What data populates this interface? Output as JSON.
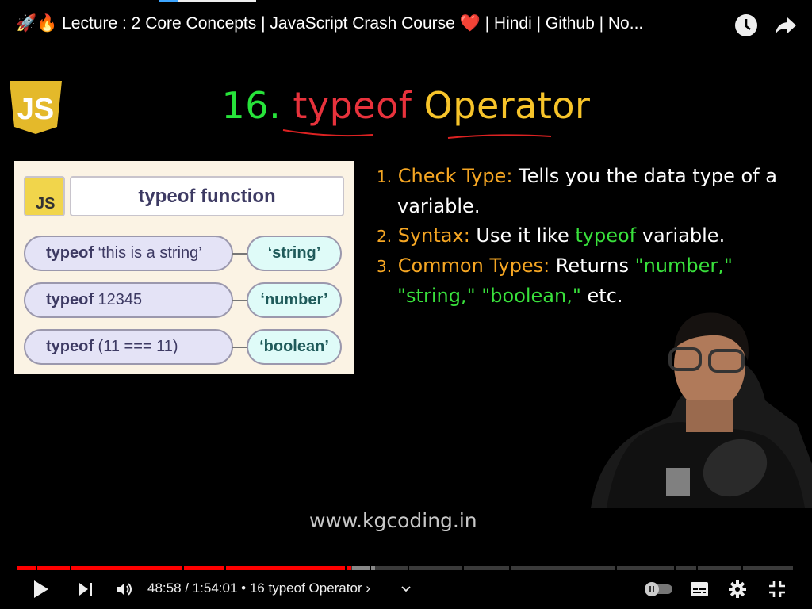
{
  "video_title": "🚀🔥 Lecture : 2 Core Concepts | JavaScript Crash Course ❤️ | Hindi | Github | No...",
  "top_icons": [
    "watch-later-icon",
    "share-icon"
  ],
  "slide": {
    "logo_text": "JS",
    "title_number": "16.",
    "title_word1": "typeof",
    "title_word2": "Operator",
    "card": {
      "badge": "JS",
      "header": "typeof function",
      "rows": [
        {
          "keyword": "typeof",
          "expr": " ‘this is a string’",
          "result": "‘string’"
        },
        {
          "keyword": "typeof",
          "expr": " 12345",
          "result": "‘number’"
        },
        {
          "keyword": "typeof",
          "expr": " (11 === 11)",
          "result": "‘boolean’"
        }
      ]
    },
    "points": [
      {
        "num": "1.",
        "label": "Check Type:",
        "text": " Tells you the data type of a variable."
      },
      {
        "num": "2.",
        "label": "Syntax:",
        "text": " Use it like ",
        "code": "typeof",
        "text2": " variable."
      },
      {
        "num": "3.",
        "label": "Common Types:",
        "text": " Returns ",
        "code": "\"number,\" \"string,\" \"boolean,\"",
        "text2": " etc."
      }
    ],
    "website": "www.kgcoding.in"
  },
  "player": {
    "current_time": "48:58",
    "duration": "1:54:01",
    "time_display": "48:58 / 1:54:01",
    "chapter": "• 16 typeof Operator",
    "played_fraction": 0.429,
    "colors": {
      "played": "#ff0000",
      "buffered": "#888888",
      "unplayed": "#3a3a3a"
    },
    "autoplay": "paused",
    "icons": [
      "play-icon",
      "next-icon",
      "volume-icon",
      "autoplay-toggle",
      "subtitles-icon",
      "settings-icon",
      "exit-fullscreen-icon"
    ]
  }
}
